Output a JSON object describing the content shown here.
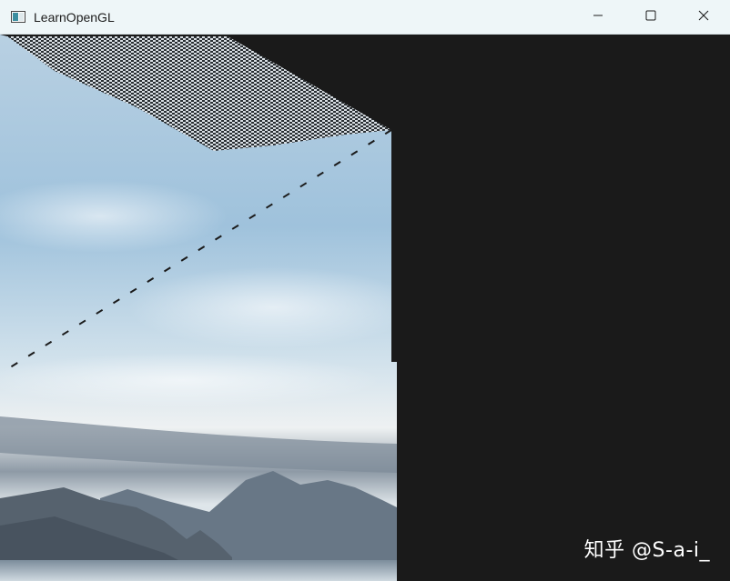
{
  "window": {
    "title": "LearnOpenGL",
    "app_icon": "window-app-icon",
    "controls": {
      "minimize_icon": "minimize-icon",
      "maximize_icon": "maximize-icon",
      "close_icon": "close-icon"
    }
  },
  "viewport": {
    "background_color": "#1a1a1a",
    "content": "skybox-render",
    "watermark": "知乎 @S-a-i_"
  },
  "colors": {
    "titlebar": "#eef6f8",
    "sky_top": "#a9c6dd",
    "sky_bottom": "#d9e6ee",
    "mountain": "#5a6874"
  }
}
